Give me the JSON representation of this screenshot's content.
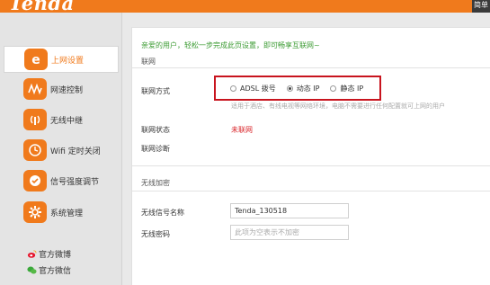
{
  "header": {
    "logo": "Tenda",
    "top_button": "简单"
  },
  "sidebar": {
    "items": [
      {
        "label": "上网设置",
        "icon": "letter-e-icon"
      },
      {
        "label": "网速控制",
        "icon": "speed-wave-icon"
      },
      {
        "label": "无线中继",
        "icon": "wireless-relay-icon"
      },
      {
        "label": "Wifi 定时关闭",
        "icon": "clock-icon"
      },
      {
        "label": "信号强度调节",
        "icon": "signal-knob-icon"
      },
      {
        "label": "系统管理",
        "icon": "gear-icon"
      }
    ],
    "social": [
      {
        "label": "官方微博",
        "icon": "weibo-icon"
      },
      {
        "label": "官方微信",
        "icon": "wechat-icon"
      }
    ]
  },
  "main": {
    "welcome": "亲爱的用户，轻松一步完成此页设置，即可畅享互联网~",
    "network": {
      "section_title": "联网",
      "mode_label": "联网方式",
      "options": [
        {
          "label": "ADSL 拨号",
          "selected": false
        },
        {
          "label": "动态 IP",
          "selected": true
        },
        {
          "label": "静态 IP",
          "selected": false
        }
      ],
      "hint": "适用于酒店、有线电视等网络环境，电脑不需要进行任何配置就可上网的用户",
      "status_label": "联网状态",
      "status_value": "未联网",
      "diag_label": "联网诊断"
    },
    "wireless": {
      "section_title": "无线加密",
      "ssid_label": "无线信号名称",
      "ssid_value": "Tenda_130518",
      "password_label": "无线密码",
      "password_placeholder": "此项为空表示不加密"
    }
  },
  "colors": {
    "brand": "#f07a1c",
    "highlight_box": "#c8141e",
    "welcome": "#3b9b32",
    "status_error": "#d9252a"
  }
}
